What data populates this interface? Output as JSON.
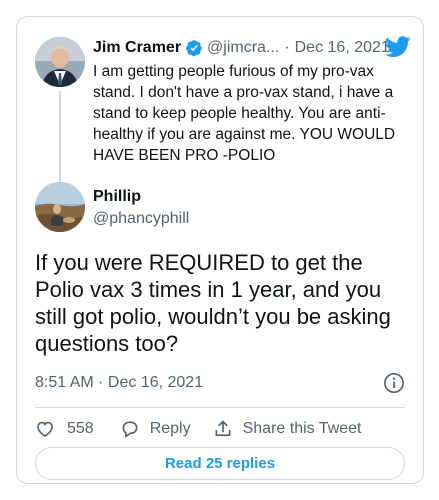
{
  "parent_tweet": {
    "name": "Jim Cramer",
    "handle": "@jimcra...",
    "separator": "·",
    "date": "Dec 16, 2021",
    "text": "I am getting people furious of my pro-vax stand. I don't have a pro-vax stand, i have a stand to keep people healthy. You are anti-healthy if you are against me. YOU WOULD HAVE BEEN PRO -POLIO"
  },
  "main_tweet": {
    "name": "Phillip",
    "handle": "@phancyphill",
    "text": "If you were REQUIRED to get the Polio vax 3 times in 1 year, and you still got polio, wouldn’t you be asking questions too?",
    "timestamp": "8:51 AM · Dec 16, 2021"
  },
  "actions": {
    "like_count": "558",
    "reply_label": "Reply",
    "share_label": "Share this Tweet"
  },
  "read_replies_label": "Read 25 replies",
  "colors": {
    "accent": "#1d9bf0",
    "text": "#0f1419",
    "secondary": "#536471",
    "border": "#cfd9de"
  },
  "icons": [
    "verified-badge-icon",
    "twitter-bird-icon",
    "info-icon",
    "heart-icon",
    "reply-icon",
    "share-icon"
  ]
}
